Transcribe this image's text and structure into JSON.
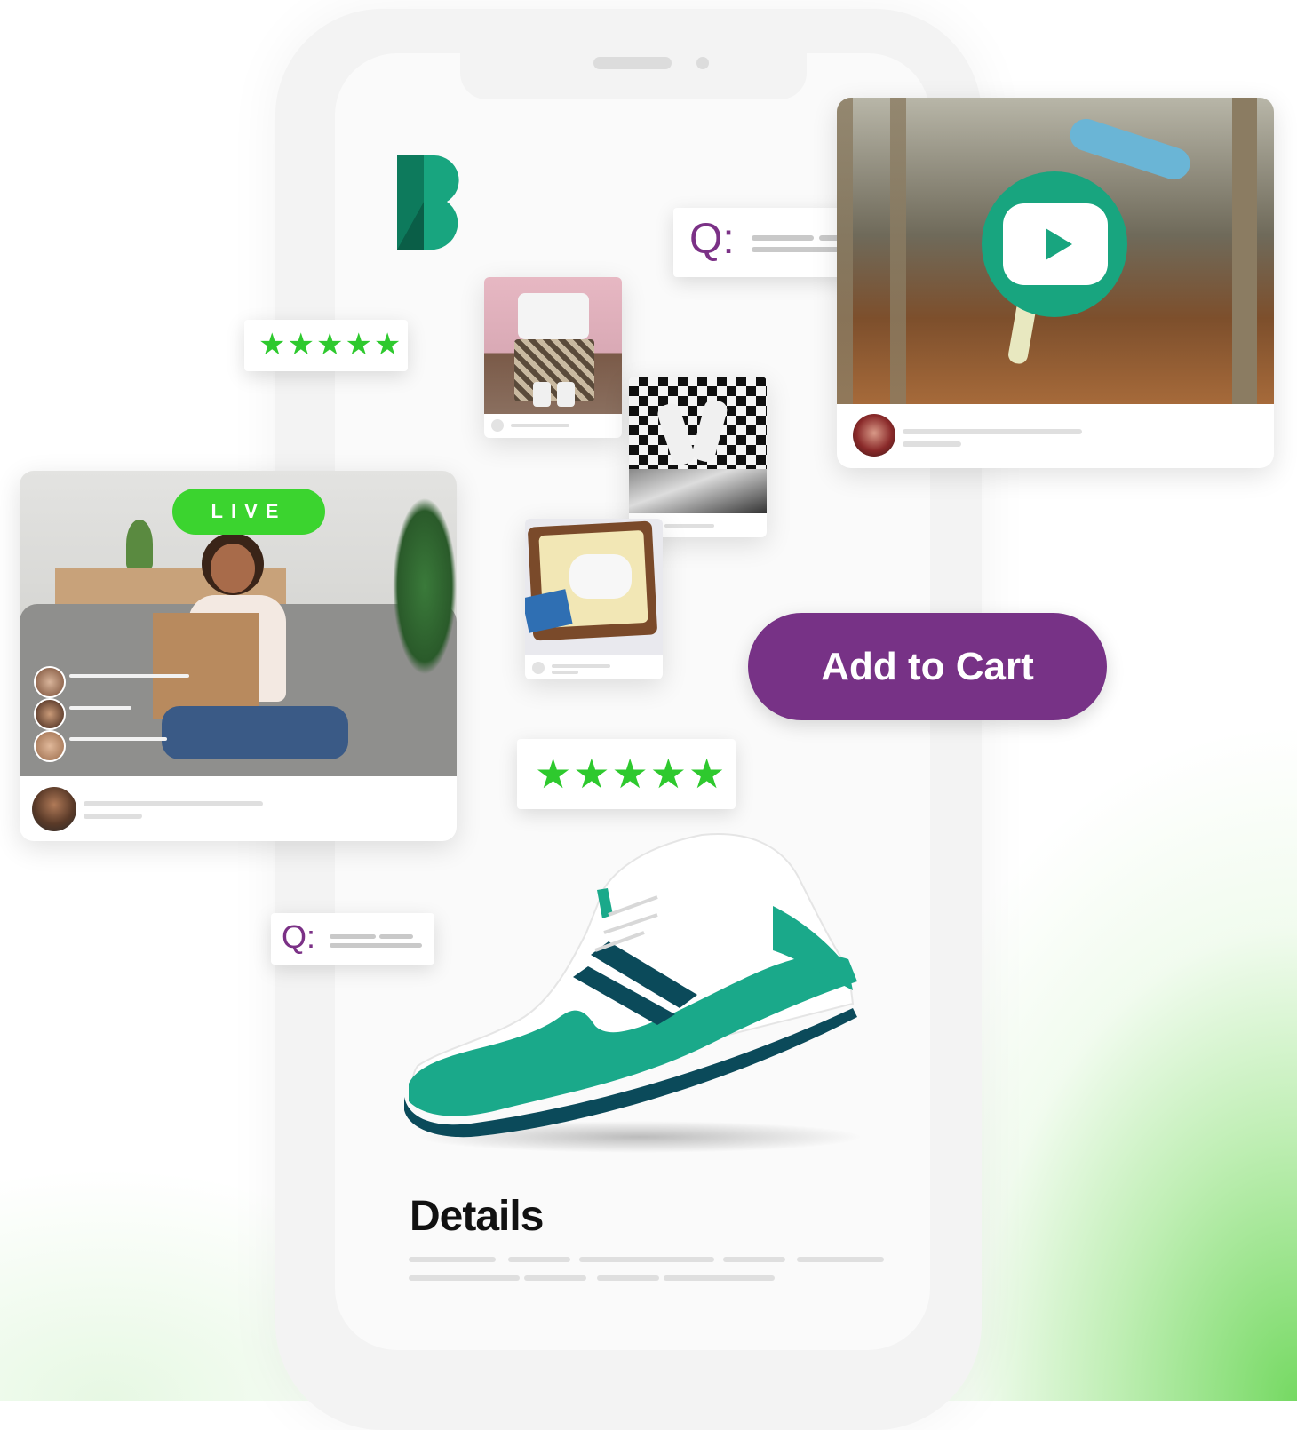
{
  "live_badge": "LIVE",
  "add_to_cart": "Add to Cart",
  "details_title": "Details",
  "q_label": "Q:",
  "rating_stars": "★★★★★",
  "colors": {
    "brand_teal": "#1a9e79",
    "brand_purple": "#773286",
    "live_green": "#3bd42f",
    "star_green": "#2ec92e"
  },
  "icons": [
    "brand-logo",
    "play-icon",
    "star-icon"
  ]
}
